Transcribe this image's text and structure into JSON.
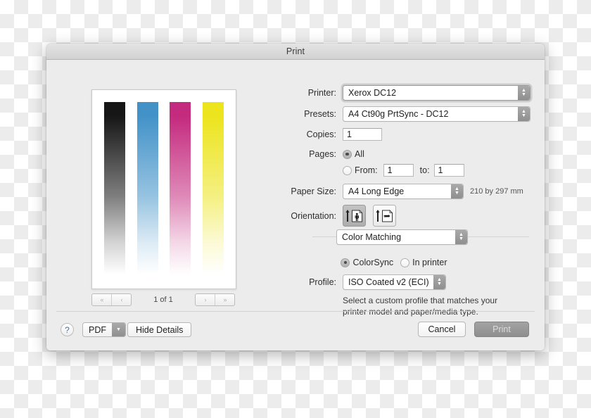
{
  "window": {
    "title": "Print"
  },
  "preview": {
    "bars": [
      {
        "name": "black-bar",
        "color": "#161616"
      },
      {
        "name": "cyan-bar",
        "color": "#4292c8"
      },
      {
        "name": "magenta-bar",
        "color": "#c42a7e"
      },
      {
        "name": "yellow-bar",
        "color": "#ece41c"
      }
    ],
    "nav": {
      "first_label": "«",
      "prev_label": "‹",
      "next_label": "›",
      "last_label": "»",
      "page_count": "1 of 1"
    }
  },
  "form": {
    "printer": {
      "label": "Printer:",
      "value": "Xerox DC12"
    },
    "presets": {
      "label": "Presets:",
      "value": "A4 Ct90g PrtSync - DC12"
    },
    "copies": {
      "label": "Copies:",
      "value": "1"
    },
    "pages": {
      "label": "Pages:",
      "all_label": "All",
      "from_label": "From:",
      "from_value": "1",
      "to_label": "to:",
      "to_value": "1"
    },
    "paper_size": {
      "label": "Paper Size:",
      "value": "A4 Long Edge",
      "dimensions": "210 by 297 mm"
    },
    "orientation": {
      "label": "Orientation:",
      "portrait_name": "portrait",
      "landscape_name": "landscape"
    },
    "pane_selector": {
      "value": "Color Matching"
    },
    "color_matching": {
      "colorsync_label": "ColorSync",
      "in_printer_label": "In printer",
      "profile_label": "Profile:",
      "profile_value": "ISO Coated v2 (ECI)",
      "help_line_1": "Select a custom profile that matches your",
      "help_line_2": "printer model and paper/media type."
    }
  },
  "bottom_bar": {
    "help_label": "?",
    "pdf_label": "PDF",
    "hide_details_label": "Hide Details",
    "cancel_label": "Cancel",
    "print_label": "Print"
  }
}
